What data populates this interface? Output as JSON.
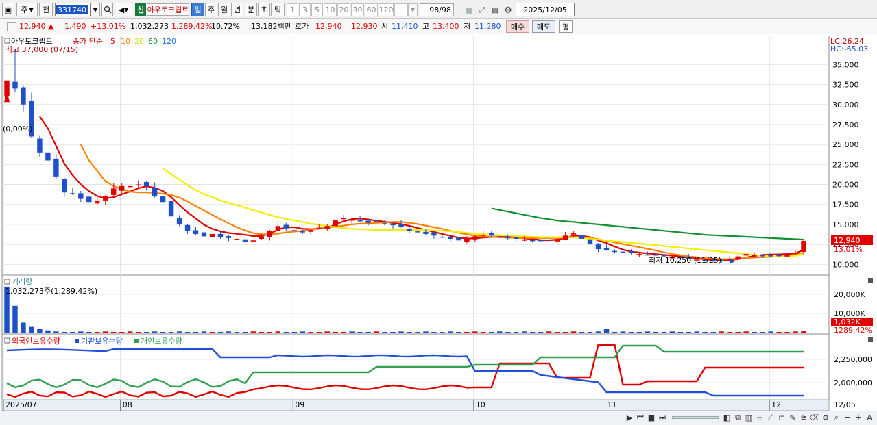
{
  "toolbar": {
    "period_unit": "주",
    "prev_label": "전",
    "code": "331740",
    "badge_new": "신",
    "stock_name": "아우토크립트",
    "periods": [
      "일",
      "주",
      "월",
      "년",
      "분",
      "초",
      "틱"
    ],
    "period_counts": [
      "1",
      "3",
      "5",
      "10",
      "20",
      "30",
      "60",
      "120"
    ],
    "page_count": "98/98",
    "date": "2025/12/05"
  },
  "quote": {
    "price": "12,940",
    "arrow": "▲",
    "change": "1,490",
    "change_pct": "+13.01%",
    "volume": "1,032,273",
    "volume_pct": "1,289.42%",
    "turnover": "10.72%",
    "amount": "13,182백만",
    "bid_label": "호가",
    "ask": "12,940",
    "bid": "12,930",
    "open_label": "시",
    "open": "11,410",
    "high_label": "고",
    "high": "13,400",
    "low_label": "저",
    "low": "11,280",
    "buy_label": "매수",
    "sell_label": "매도",
    "avg_label": "평"
  },
  "price_chart": {
    "legend_name": "아우토크립트",
    "legend_type": "종가 단순",
    "ma_labels": [
      "5",
      "10",
      "20",
      "60",
      "120"
    ],
    "ma_colors": [
      "#e00000",
      "#ff8000",
      "#e8e800",
      "#109030",
      "#1e6bd6"
    ],
    "high_note": "최고 37,000 (07/15)",
    "low_note": "최저 10,250 (11/25)",
    "left_note": "(0,00%)",
    "lc": "LC:26.24",
    "hc": "HC:-65.03",
    "y_ticks": [
      "35,000",
      "32,500",
      "30,000",
      "27,500",
      "25,000",
      "22,500",
      "20,000",
      "17,500",
      "15,000",
      "12,500",
      "10,000"
    ],
    "cur_price": "12,940",
    "cur_pct": "13.01%"
  },
  "volume_chart": {
    "title": "거래량",
    "value_note": "1,032,273주(1,289.42%)",
    "y_ticks": [
      "20,000K",
      "10,000K"
    ],
    "cur_value": "1,032K",
    "cur_pct": "1289.42%"
  },
  "holding_chart": {
    "legend": [
      "외국인보유수량",
      "기관보유수량",
      "개인보유수량"
    ],
    "colors": [
      "#e00000",
      "#2050d8",
      "#30a050"
    ],
    "y_ticks": [
      "2,250,000",
      "2,000,000"
    ]
  },
  "x_axis": {
    "labels": [
      "2025/07",
      "08",
      "09",
      "10",
      "11",
      "12"
    ],
    "end_label": "12/05"
  },
  "chart_data": {
    "type": "candlestick",
    "x": [
      "07/14",
      "07/15",
      "07/16",
      "07/17",
      "07/18",
      "07/21",
      "07/22",
      "07/23",
      "07/24",
      "07/25",
      "07/28",
      "07/29",
      "07/30",
      "07/31",
      "08/01",
      "08/04",
      "08/05",
      "08/06",
      "08/07",
      "08/08",
      "08/11",
      "08/12",
      "08/13",
      "08/14",
      "08/18",
      "08/19",
      "08/20",
      "08/21",
      "08/22",
      "08/25",
      "08/26",
      "08/27",
      "08/28",
      "08/29",
      "09/01",
      "09/02",
      "09/03",
      "09/04",
      "09/05",
      "09/08",
      "09/09",
      "09/10",
      "09/11",
      "09/12",
      "09/15",
      "09/16",
      "09/17",
      "09/18",
      "09/19",
      "09/22",
      "09/23",
      "09/24",
      "09/25",
      "09/26",
      "09/29",
      "09/30",
      "10/01",
      "10/02",
      "10/10",
      "10/13",
      "10/14",
      "10/15",
      "10/16",
      "10/17",
      "10/20",
      "10/21",
      "10/22",
      "10/23",
      "10/24",
      "10/27",
      "10/28",
      "10/29",
      "10/30",
      "10/31",
      "11/03",
      "11/04",
      "11/05",
      "11/06",
      "11/07",
      "11/10",
      "11/11",
      "11/12",
      "11/13",
      "11/14",
      "11/17",
      "11/18",
      "11/19",
      "11/20",
      "11/21",
      "11/24",
      "11/25",
      "11/26",
      "11/27",
      "11/28",
      "12/01",
      "12/02",
      "12/03",
      "12/04",
      "12/05"
    ],
    "close": [
      33000,
      32000,
      30000,
      26000,
      24000,
      23000,
      21000,
      19000,
      18800,
      18200,
      17800,
      18000,
      18500,
      19500,
      19800,
      19800,
      20000,
      19800,
      18500,
      17800,
      16000,
      15000,
      14200,
      13800,
      13500,
      13800,
      13400,
      13300,
      13200,
      12800,
      13000,
      13500,
      14200,
      14800,
      14500,
      14200,
      14000,
      14300,
      14600,
      14800,
      15500,
      15800,
      15600,
      15400,
      15200,
      15300,
      15100,
      14900,
      14700,
      14200,
      14000,
      13800,
      13600,
      13400,
      13200,
      13000,
      13200,
      13500,
      13700,
      13600,
      13400,
      13300,
      13200,
      13100,
      13000,
      12900,
      13000,
      13100,
      13600,
      13900,
      13200,
      12500,
      11900,
      11800,
      11600,
      11500,
      11400,
      11300,
      11200,
      11100,
      11000,
      10900,
      10850,
      10700,
      10600,
      10500,
      10400,
      10500,
      10700,
      11000,
      11300,
      11200,
      11100,
      11000,
      11100,
      11300,
      11450,
      12940
    ],
    "series": [
      {
        "name": "5",
        "values": [
          null,
          null,
          null,
          null,
          28500,
          27000,
          24800,
          22600,
          21160,
          20000,
          19160,
          18560,
          18260,
          18400,
          18760,
          19120,
          19520,
          19780,
          19580,
          19180,
          18420,
          17420,
          16500,
          15760,
          14960,
          14460,
          14140,
          13920,
          13820,
          13700,
          13540,
          13560,
          13820,
          14340,
          14680,
          14640,
          14460,
          14400,
          14460,
          14580,
          15000,
          15400,
          15660,
          15760,
          15620,
          15460,
          15340,
          15180,
          15040,
          14820,
          14560,
          14320,
          14060,
          13800,
          13560,
          13340,
          13240,
          13260,
          13360,
          13440,
          13460,
          13440,
          13360,
          13260,
          13160,
          13040,
          13020,
          13100,
          13300,
          13600,
          13560,
          13400,
          13000,
          12660,
          12240,
          11840,
          11600,
          11480,
          11380,
          11280,
          11200,
          11100,
          11000,
          10890,
          10750,
          10630,
          10520,
          10500,
          10520,
          10640,
          10860,
          11060,
          11180,
          11240,
          11260,
          11300,
          11360,
          11850
        ]
      },
      {
        "name": "10",
        "values": [
          null,
          null,
          null,
          null,
          null,
          null,
          null,
          null,
          null,
          25000,
          23000,
          21700,
          20400,
          19800,
          19400,
          19100,
          19000,
          19000,
          18950,
          18850,
          18700,
          18350,
          17870,
          17300,
          16750,
          16200,
          15650,
          15150,
          14650,
          14250,
          13900,
          13750,
          13750,
          13850,
          14000,
          14100,
          14200,
          14300,
          14500,
          14600,
          14700,
          14850,
          15000,
          15100,
          15150,
          15200,
          15250,
          15300,
          15300,
          15200,
          15050,
          14850,
          14650,
          14450,
          14200,
          13950,
          13750,
          13600,
          13500,
          13450,
          13400,
          13350,
          13300,
          13300,
          13300,
          13300,
          13300,
          13300,
          13350,
          13400,
          13350,
          13300,
          13150,
          12950,
          12750,
          12550,
          12350,
          12150,
          11950,
          11750,
          11500,
          11300,
          11150,
          11000,
          10900,
          10800,
          10700,
          10650,
          10650,
          10700,
          10800,
          10850,
          10900,
          10950,
          11000,
          11100,
          11200,
          11450
        ]
      },
      {
        "name": "20",
        "values": [
          null,
          null,
          null,
          null,
          null,
          null,
          null,
          null,
          null,
          null,
          null,
          null,
          null,
          null,
          null,
          null,
          null,
          null,
          null,
          22000,
          21300,
          20600,
          19900,
          19300,
          18800,
          18400,
          18000,
          17700,
          17400,
          17100,
          16800,
          16500,
          16200,
          15900,
          15700,
          15500,
          15300,
          15100,
          14950,
          14800,
          14650,
          14550,
          14450,
          14400,
          14350,
          14300,
          14300,
          14300,
          14300,
          14300,
          14300,
          14300,
          14250,
          14200,
          14150,
          14050,
          13950,
          13850,
          13750,
          13700,
          13650,
          13600,
          13550,
          13500,
          13450,
          13400,
          13400,
          13400,
          13400,
          13400,
          13300,
          13200,
          13100,
          13000,
          12900,
          12800,
          12700,
          12600,
          12500,
          12400,
          12300,
          12200,
          12100,
          12000,
          11900,
          11800,
          11700,
          11600,
          11500,
          11400,
          11300,
          11200,
          11100,
          11000,
          11000,
          11000,
          11100,
          11300
        ]
      },
      {
        "name": "60",
        "values": [
          null,
          null,
          null,
          null,
          null,
          null,
          null,
          null,
          null,
          null,
          null,
          null,
          null,
          null,
          null,
          null,
          null,
          null,
          null,
          null,
          null,
          null,
          null,
          null,
          null,
          null,
          null,
          null,
          null,
          null,
          null,
          null,
          null,
          null,
          null,
          null,
          null,
          null,
          null,
          null,
          null,
          null,
          null,
          null,
          null,
          null,
          null,
          null,
          null,
          null,
          null,
          null,
          null,
          null,
          null,
          null,
          null,
          null,
          null,
          17000,
          16800,
          16600,
          16400,
          16200,
          16000,
          15800,
          15650,
          15500,
          15400,
          15300,
          15200,
          15100,
          15000,
          14900,
          14800,
          14700,
          14600,
          14500,
          14400,
          14300,
          14200,
          14100,
          14000,
          13900,
          13800,
          13700,
          13650,
          13600,
          13550,
          13500,
          13450,
          13400,
          13350,
          13300,
          13250,
          13200,
          13150,
          13100
        ]
      }
    ],
    "y_range": [
      9000,
      37600
    ],
    "high_point": {
      "date": "07/15",
      "value": 37000
    },
    "low_point": {
      "date": "11/25",
      "value": 10250
    }
  }
}
